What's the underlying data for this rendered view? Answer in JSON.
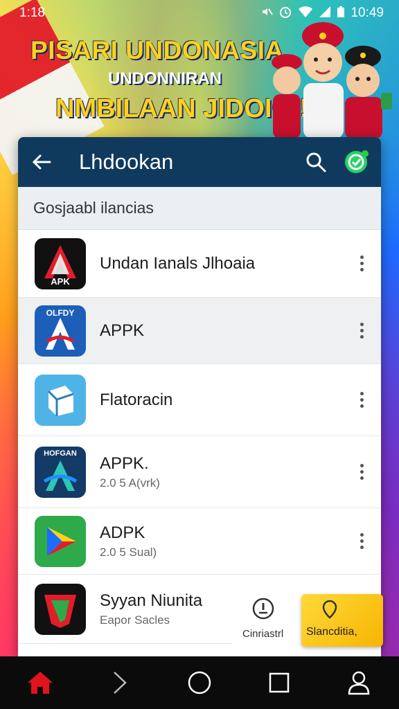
{
  "status_bar": {
    "time": "1:18",
    "clock": "10:49",
    "icons": [
      "mute-icon",
      "alarm-icon",
      "wifi-icon",
      "signal-icon",
      "battery-icon"
    ]
  },
  "banner": {
    "title": "PISARI UNDONASIA",
    "subtitle": "UNDONNIRAN",
    "subtitle2": "NMBILAAN JIDOIOI!!"
  },
  "app_bar": {
    "title": "Lhdookan",
    "icons": [
      "back-arrow-icon",
      "search-icon",
      "whatsapp-icon"
    ]
  },
  "section": {
    "header": "Gosjaabl ilancias"
  },
  "apps": [
    {
      "name": "Undan Ianals Jlhoaia",
      "sub": "",
      "icon_text": "APK",
      "icon": "apk-a-icon"
    },
    {
      "name": "APPK",
      "sub": "",
      "icon_text": "OLFDY",
      "icon": "apk-blue-icon"
    },
    {
      "name": "Flatoracin",
      "sub": "",
      "icon_text": "",
      "icon": "cube-icon"
    },
    {
      "name": "APPK.",
      "sub": "2.0 5 A(vrk)",
      "icon_text": "HOFGAN",
      "icon": "apk-dark-icon"
    },
    {
      "name": "ADPK",
      "sub": "2.0 5 Sual)",
      "icon_text": "",
      "icon": "play-arrow-icon"
    },
    {
      "name": "Syyan Niunita",
      "sub": "Eapor Sacles",
      "icon_text": "",
      "icon": "shield-icon"
    }
  ],
  "overlay_actions": {
    "left_label": "Cinriastrl",
    "right_label": "Slancditia,"
  },
  "nav_bar": {
    "items": [
      "home-icon",
      "forward-icon",
      "circle-home-icon",
      "recents-icon",
      "profile-icon"
    ]
  },
  "colors": {
    "app_bar": "#0f3a5e",
    "accent_yellow": "#ffd21a",
    "home_red": "#e0141c"
  }
}
